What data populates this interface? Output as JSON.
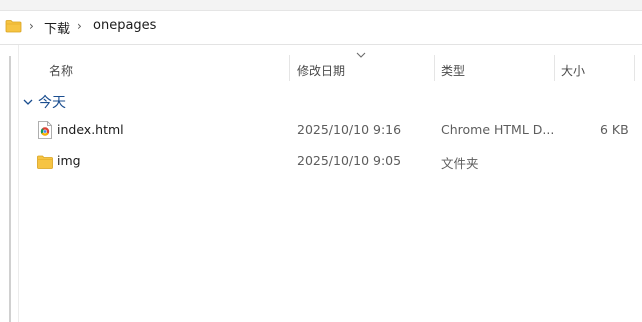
{
  "breadcrumb": {
    "items": [
      "下载",
      "onepages"
    ]
  },
  "columns": {
    "name": "名称",
    "modified": "修改日期",
    "type": "类型",
    "size": "大小"
  },
  "group": {
    "label": "今天"
  },
  "files": [
    {
      "name": "index.html",
      "modified": "2025/10/10 9:16",
      "type": "Chrome HTML D...",
      "size": "6 KB",
      "icon": "chrome-html-file-icon"
    },
    {
      "name": "img",
      "modified": "2025/10/10 9:05",
      "type": "文件夹",
      "size": "",
      "icon": "folder-icon"
    }
  ],
  "colors": {
    "group_label": "#1a4d8f",
    "folder_yellow": "#f6c443",
    "chrome_red": "#db4437",
    "chrome_green": "#0f9d58",
    "chrome_yellow": "#f4b400",
    "chrome_blue": "#4285f4"
  }
}
